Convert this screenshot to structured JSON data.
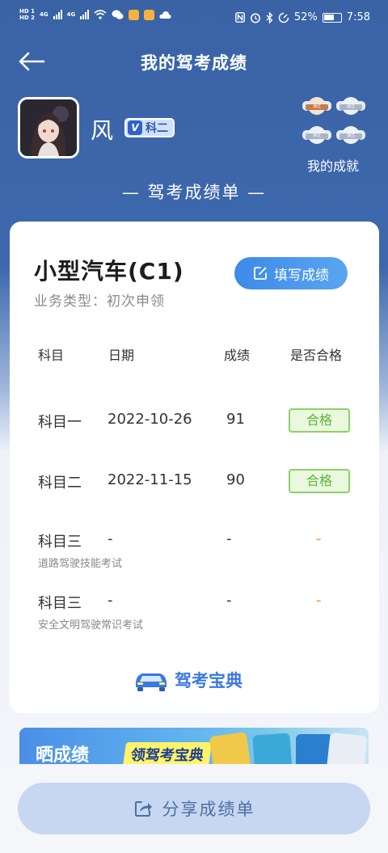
{
  "status_bar": {
    "hd1": "HD 1",
    "hd2": "HD 2",
    "net1": "4G",
    "net2": "4G",
    "battery_percent": "52%",
    "time": "7:58"
  },
  "header": {
    "title": "我的驾考成绩"
  },
  "profile": {
    "name": "风",
    "level_mark": "V",
    "level": "科二",
    "achievements_label": "我的成就",
    "medals": [
      {
        "ribbon": "通过",
        "color": "#c47c4a"
      },
      {
        "ribbon": "通过",
        "color": "#a9b4c7"
      },
      {
        "ribbon": "通过",
        "color": "#a9b4c7"
      },
      {
        "ribbon": "通过",
        "color": "#a9b4c7"
      }
    ]
  },
  "section_title": "— 驾考成绩单 —",
  "card": {
    "vehicle": "小型汽车(C1)",
    "business_type": "业务类型：初次申领",
    "fill_button": "填写成绩",
    "columns": {
      "subject": "科目",
      "date": "日期",
      "score": "成绩",
      "pass": "是否合格"
    },
    "rows": [
      {
        "subject": "科目一",
        "date": "2022-10-26",
        "score": "91",
        "pass": "合格",
        "note": ""
      },
      {
        "subject": "科目二",
        "date": "2022-11-15",
        "score": "90",
        "pass": "合格",
        "note": ""
      },
      {
        "subject": "科目三",
        "date": "-",
        "score": "-",
        "pass": "-",
        "note": "道路驾驶技能考试"
      },
      {
        "subject": "科目三",
        "date": "-",
        "score": "-",
        "pass": "-",
        "note": "安全文明驾驶常识考试"
      }
    ],
    "brand": "驾考宝典"
  },
  "banner": {
    "text1": "晒成绩",
    "text2": "领驾考宝典"
  },
  "share_button": "分享成绩单",
  "colors": {
    "header_blue": "#3e68ad",
    "accent_blue": "#3d8ae8",
    "pass_green": "#5cb43a",
    "pending_orange": "#ff8a2a"
  },
  "icons": [
    "back-arrow-icon",
    "edit-icon",
    "share-icon",
    "car-logo-icon"
  ]
}
